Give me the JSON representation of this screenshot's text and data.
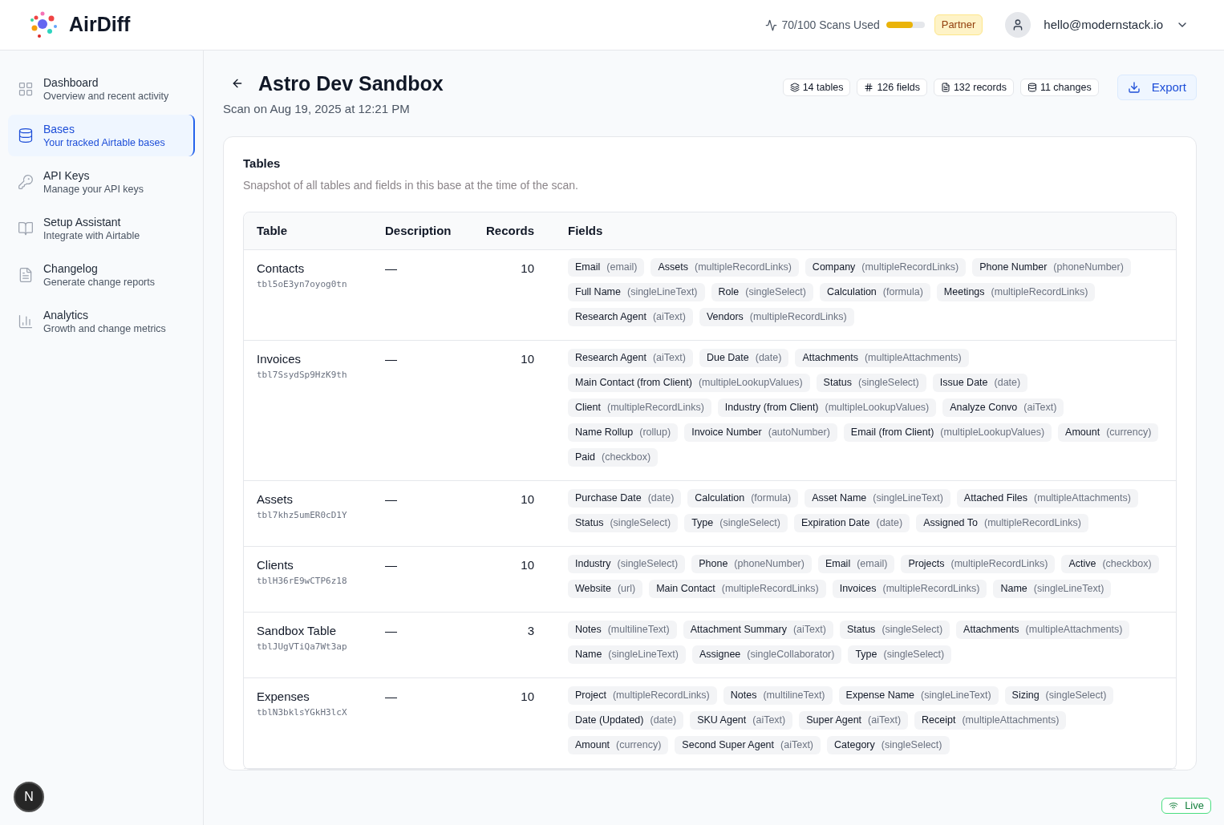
{
  "header": {
    "brand": "AirDiff",
    "usage": {
      "label": "70/100 Scans Used",
      "level": 0.7
    },
    "plan_badge": "Partner",
    "user_email": "hello@modernstack.io"
  },
  "sidebar": {
    "items": [
      {
        "kind": "grid",
        "title": "Dashboard",
        "subtitle": "Overview and recent activity",
        "selected": false
      },
      {
        "kind": "database",
        "title": "Bases",
        "subtitle": "Your tracked Airtable bases",
        "selected": true
      },
      {
        "kind": "key",
        "title": "API Keys",
        "subtitle": "Manage your API keys",
        "selected": false
      },
      {
        "kind": "book",
        "title": "Setup Assistant",
        "subtitle": "Integrate with Airtable",
        "selected": false
      },
      {
        "kind": "file",
        "title": "Changelog",
        "subtitle": "Generate change reports",
        "selected": false
      },
      {
        "kind": "chart",
        "title": "Analytics",
        "subtitle": "Growth and change metrics",
        "selected": false
      }
    ],
    "dev_badge": "N"
  },
  "page": {
    "title": "Astro Dev Sandbox",
    "subtitle": "Scan on Aug 19, 2025 at 12:21 PM",
    "stats": [
      {
        "kind": "layers",
        "label": "14 tables"
      },
      {
        "kind": "hash",
        "label": "126 fields"
      },
      {
        "kind": "file",
        "label": "132 records"
      },
      {
        "kind": "database",
        "label": "11 changes"
      }
    ],
    "export_button": "Export"
  },
  "tables_card": {
    "title": "Tables",
    "description": "Snapshot of all tables and fields in this base at the time of the scan.",
    "columns": [
      "Table",
      "Description",
      "Records",
      "Fields"
    ],
    "rows": [
      {
        "name": "Contacts",
        "id": "tbl5oE3yn7oyog0tn",
        "description": "—",
        "records": "10",
        "fields": [
          [
            "Email",
            "(email)"
          ],
          [
            "Assets",
            "(multipleRecordLinks)"
          ],
          [
            "Company",
            "(multipleRecordLinks)"
          ],
          [
            "Phone Number",
            "(phoneNumber)"
          ],
          [
            "Full Name",
            "(singleLineText)"
          ],
          [
            "Role",
            "(singleSelect)"
          ],
          [
            "Calculation",
            "(formula)"
          ],
          [
            "Meetings",
            "(multipleRecordLinks)"
          ],
          [
            "Research Agent",
            "(aiText)"
          ],
          [
            "Vendors",
            "(multipleRecordLinks)"
          ]
        ]
      },
      {
        "name": "Invoices",
        "id": "tbl7SsydSp9HzK9th",
        "description": "—",
        "records": "10",
        "fields": [
          [
            "Research Agent",
            "(aiText)"
          ],
          [
            "Due Date",
            "(date)"
          ],
          [
            "Attachments",
            "(multipleAttachments)"
          ],
          [
            "Main Contact (from Client)",
            "(multipleLookupValues)"
          ],
          [
            "Status",
            "(singleSelect)"
          ],
          [
            "Issue Date",
            "(date)"
          ],
          [
            "Client",
            "(multipleRecordLinks)"
          ],
          [
            "Industry (from Client)",
            "(multipleLookupValues)"
          ],
          [
            "Analyze Convo",
            "(aiText)"
          ],
          [
            "Name Rollup",
            "(rollup)"
          ],
          [
            "Invoice Number",
            "(autoNumber)"
          ],
          [
            "Email (from Client)",
            "(multipleLookupValues)"
          ],
          [
            "Amount",
            "(currency)"
          ],
          [
            "Paid",
            "(checkbox)"
          ]
        ]
      },
      {
        "name": "Assets",
        "id": "tbl7khz5umER0cD1Y",
        "description": "—",
        "records": "10",
        "fields": [
          [
            "Purchase Date",
            "(date)"
          ],
          [
            "Calculation",
            "(formula)"
          ],
          [
            "Asset Name",
            "(singleLineText)"
          ],
          [
            "Attached Files",
            "(multipleAttachments)"
          ],
          [
            "Status",
            "(singleSelect)"
          ],
          [
            "Type",
            "(singleSelect)"
          ],
          [
            "Expiration Date",
            "(date)"
          ],
          [
            "Assigned To",
            "(multipleRecordLinks)"
          ]
        ]
      },
      {
        "name": "Clients",
        "id": "tblH36rE9wCTP6z18",
        "description": "—",
        "records": "10",
        "fields": [
          [
            "Industry",
            "(singleSelect)"
          ],
          [
            "Phone",
            "(phoneNumber)"
          ],
          [
            "Email",
            "(email)"
          ],
          [
            "Projects",
            "(multipleRecordLinks)"
          ],
          [
            "Active",
            "(checkbox)"
          ],
          [
            "Website",
            "(url)"
          ],
          [
            "Main Contact",
            "(multipleRecordLinks)"
          ],
          [
            "Invoices",
            "(multipleRecordLinks)"
          ],
          [
            "Name",
            "(singleLineText)"
          ]
        ]
      },
      {
        "name": "Sandbox Table",
        "id": "tblJUgVTiQa7Wt3ap",
        "description": "—",
        "records": "3",
        "fields": [
          [
            "Notes",
            "(multilineText)"
          ],
          [
            "Attachment Summary",
            "(aiText)"
          ],
          [
            "Status",
            "(singleSelect)"
          ],
          [
            "Attachments",
            "(multipleAttachments)"
          ],
          [
            "Name",
            "(singleLineText)"
          ],
          [
            "Assignee",
            "(singleCollaborator)"
          ],
          [
            "Type",
            "(singleSelect)"
          ]
        ]
      },
      {
        "name": "Expenses",
        "id": "tblN3bklsYGkH3lcX",
        "description": "—",
        "records": "10",
        "fields": [
          [
            "Project",
            "(multipleRecordLinks)"
          ],
          [
            "Notes",
            "(multilineText)"
          ],
          [
            "Expense Name",
            "(singleLineText)"
          ],
          [
            "Sizing",
            "(singleSelect)"
          ],
          [
            "Date (Updated)",
            "(date)"
          ],
          [
            "SKU Agent",
            "(aiText)"
          ],
          [
            "Super Agent",
            "(aiText)"
          ],
          [
            "Receipt",
            "(multipleAttachments)"
          ],
          [
            "Amount",
            "(currency)"
          ],
          [
            "Second Super Agent",
            "(aiText)"
          ],
          [
            "Category",
            "(singleSelect)"
          ]
        ]
      }
    ]
  },
  "live_badge": "Live"
}
